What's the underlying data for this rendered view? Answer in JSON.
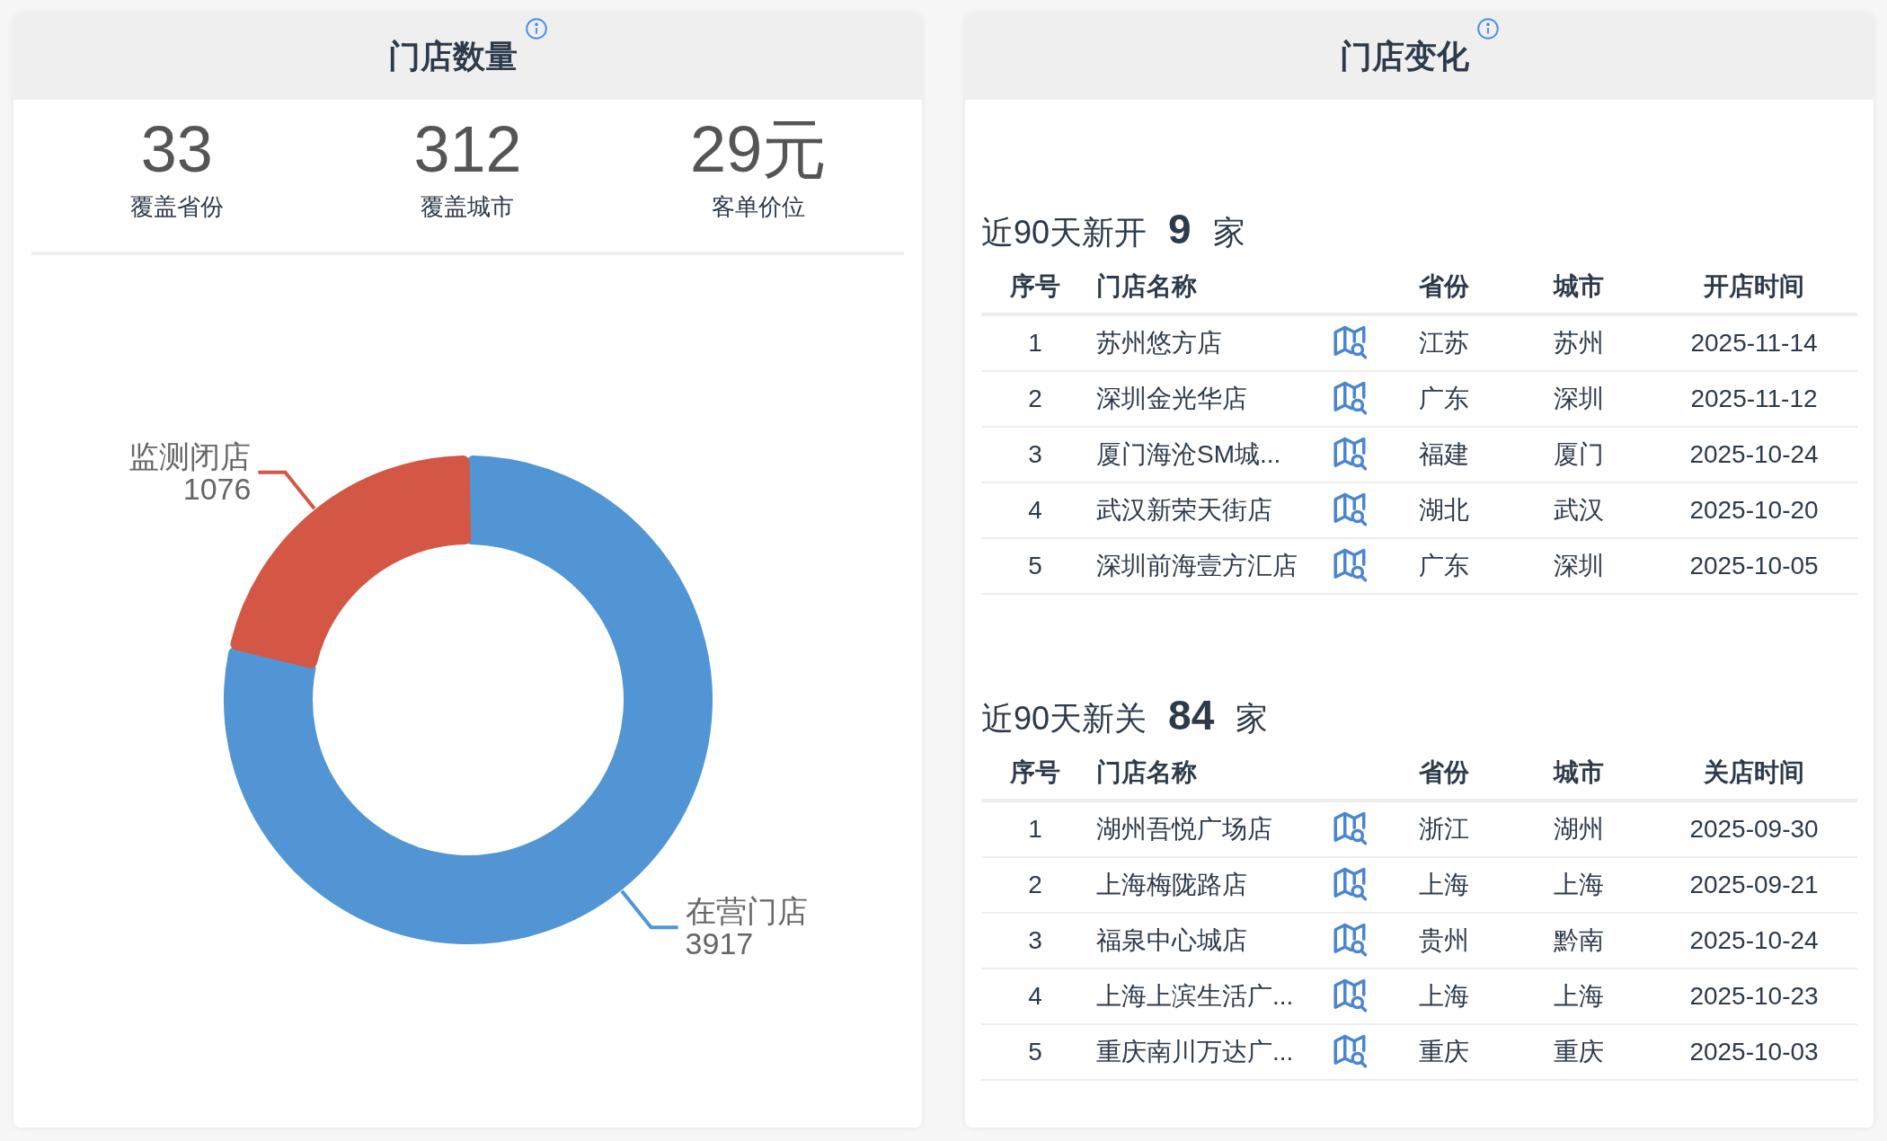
{
  "store_count": {
    "title": "门店数量",
    "stats": [
      {
        "value": "33",
        "label": "覆盖省份"
      },
      {
        "value": "312",
        "label": "覆盖城市"
      },
      {
        "value": "29元",
        "label": "客单价位"
      }
    ],
    "chart_data": {
      "type": "donut",
      "categories": [
        "在营门店",
        "监测闭店"
      ],
      "values": [
        3917,
        1076
      ],
      "data_labels": true
    }
  },
  "store_change": {
    "title": "门店变化",
    "sections": [
      {
        "title": "近90天新开",
        "count": "9",
        "unit": "家",
        "columns": [
          "序号",
          "门店名称",
          "省份",
          "城市",
          "开店时间"
        ],
        "rows": [
          [
            "1",
            "苏州悠方店",
            "江苏",
            "苏州",
            "2025-11-14"
          ],
          [
            "2",
            "深圳金光华店",
            "广东",
            "深圳",
            "2025-11-12"
          ],
          [
            "3",
            "厦门海沧SM城...",
            "福建",
            "厦门",
            "2025-10-24"
          ],
          [
            "4",
            "武汉新荣天街店",
            "湖北",
            "武汉",
            "2025-10-20"
          ],
          [
            "5",
            "深圳前海壹方汇店",
            "广东",
            "深圳",
            "2025-10-05"
          ]
        ]
      },
      {
        "title": "近90天新关",
        "count": "84",
        "unit": "家",
        "columns": [
          "序号",
          "门店名称",
          "省份",
          "城市",
          "关店时间"
        ],
        "rows": [
          [
            "1",
            "湖州吾悦广场店",
            "浙江",
            "湖州",
            "2025-09-30"
          ],
          [
            "2",
            "上海梅陇路店",
            "上海",
            "上海",
            "2025-09-21"
          ],
          [
            "3",
            "福泉中心城店",
            "贵州",
            "黔南",
            "2025-10-24"
          ],
          [
            "4",
            "上海上滨生活广...",
            "上海",
            "上海",
            "2025-10-23"
          ],
          [
            "5",
            "重庆南川万达广...",
            "重庆",
            "重庆",
            "2025-10-03"
          ]
        ]
      }
    ]
  }
}
